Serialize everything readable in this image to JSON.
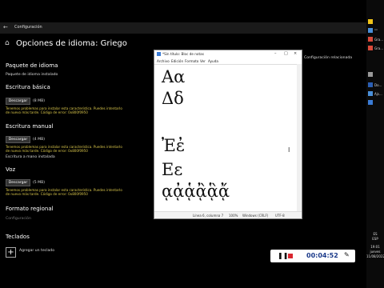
{
  "settings": {
    "app_title": "Configuración",
    "page_title": "Opciones de idioma: Griego",
    "language_pack": {
      "heading": "Paquete de idioma",
      "status": "Paquete de idioma instalado"
    },
    "basic_typing": {
      "heading": "Escritura básica",
      "button": "Descargar",
      "size": "(8 MB)",
      "error": "Tenemos problemas para instalar esta característica. Puedes intentarlo de nuevo más tarde. Código de error: 0x800f0950"
    },
    "handwriting": {
      "heading": "Escritura manual",
      "button": "Descargar",
      "size": "(4 MB)",
      "error": "Tenemos problemas para instalar esta característica. Puedes intentarlo de nuevo más tarde. Código de error: 0x800f0950",
      "status": "Escritura a mano instalada"
    },
    "voice": {
      "heading": "Voz",
      "button": "Descargar",
      "size": "(5 MB)",
      "error": "Tenemos problemas para instalar esta característica. Puedes intentarlo de nuevo más tarde. Código de error: 0x800f0950"
    },
    "regional_format": {
      "heading": "Formato regional",
      "link": "Configuración"
    },
    "keyboards": {
      "heading": "Teclados",
      "add": "Agregar un teclado"
    },
    "side_label": "Configuración relacionada"
  },
  "notepad": {
    "title": "*Sin título: Bloc de notas",
    "menu": [
      "Archivo",
      "Edición",
      "Formato",
      "Ver",
      "Ayuda"
    ],
    "lines": [
      "Αα",
      "Δδ",
      "",
      "",
      "Ἐἐ",
      "Εε",
      "ᾳᾀᾁᾂᾃᾄ"
    ],
    "status": {
      "position": "Línea 6, columna 7",
      "zoom": "100%",
      "eol": "Windows (CRLF)",
      "encoding": "UTF-8"
    }
  },
  "taskbar": {
    "items": [
      "",
      "\"\"",
      "Gra...",
      "Gra...",
      "",
      "Do...",
      "Ajs...",
      ""
    ],
    "lang": "ES",
    "locale": "ESP",
    "time": "19:01",
    "day": "jueves",
    "date": "11/08/2022"
  },
  "recorder": {
    "time": "00:04:52"
  },
  "colors": {
    "error_text": "#d8c54a",
    "recorder_stop": "#d9262f",
    "timer": "#1b3a8a"
  }
}
